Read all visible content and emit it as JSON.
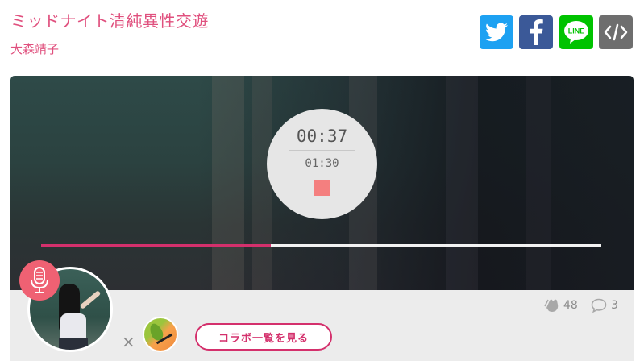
{
  "song": {
    "title": "ミッドナイト清純異性交遊",
    "artist": "大森靖子"
  },
  "share": {
    "twitter_icon": "twitter-icon",
    "facebook_icon": "facebook-icon",
    "line_icon": "line-icon",
    "line_label": "LINE",
    "embed_icon": "code-embed-icon",
    "embed_label": "</>"
  },
  "player": {
    "current_time": "00:37",
    "total_time": "01:30",
    "progress_fraction": 0.41,
    "stop_icon": "stop-icon"
  },
  "footer": {
    "mic_icon": "microphone-icon",
    "times_glyph": "×",
    "collab_button_label": "コラボ一覧を見る",
    "applause_count": "48",
    "comment_count": "3",
    "applause_icon": "clap-icon",
    "comment_icon": "comment-icon"
  },
  "colors": {
    "accent_pink": "#e0507e",
    "progress": "#d4306c",
    "twitter": "#1da1f2",
    "facebook": "#3b5998",
    "line": "#00c300",
    "embed": "#6e6e6e",
    "stop": "#f47f7f"
  }
}
